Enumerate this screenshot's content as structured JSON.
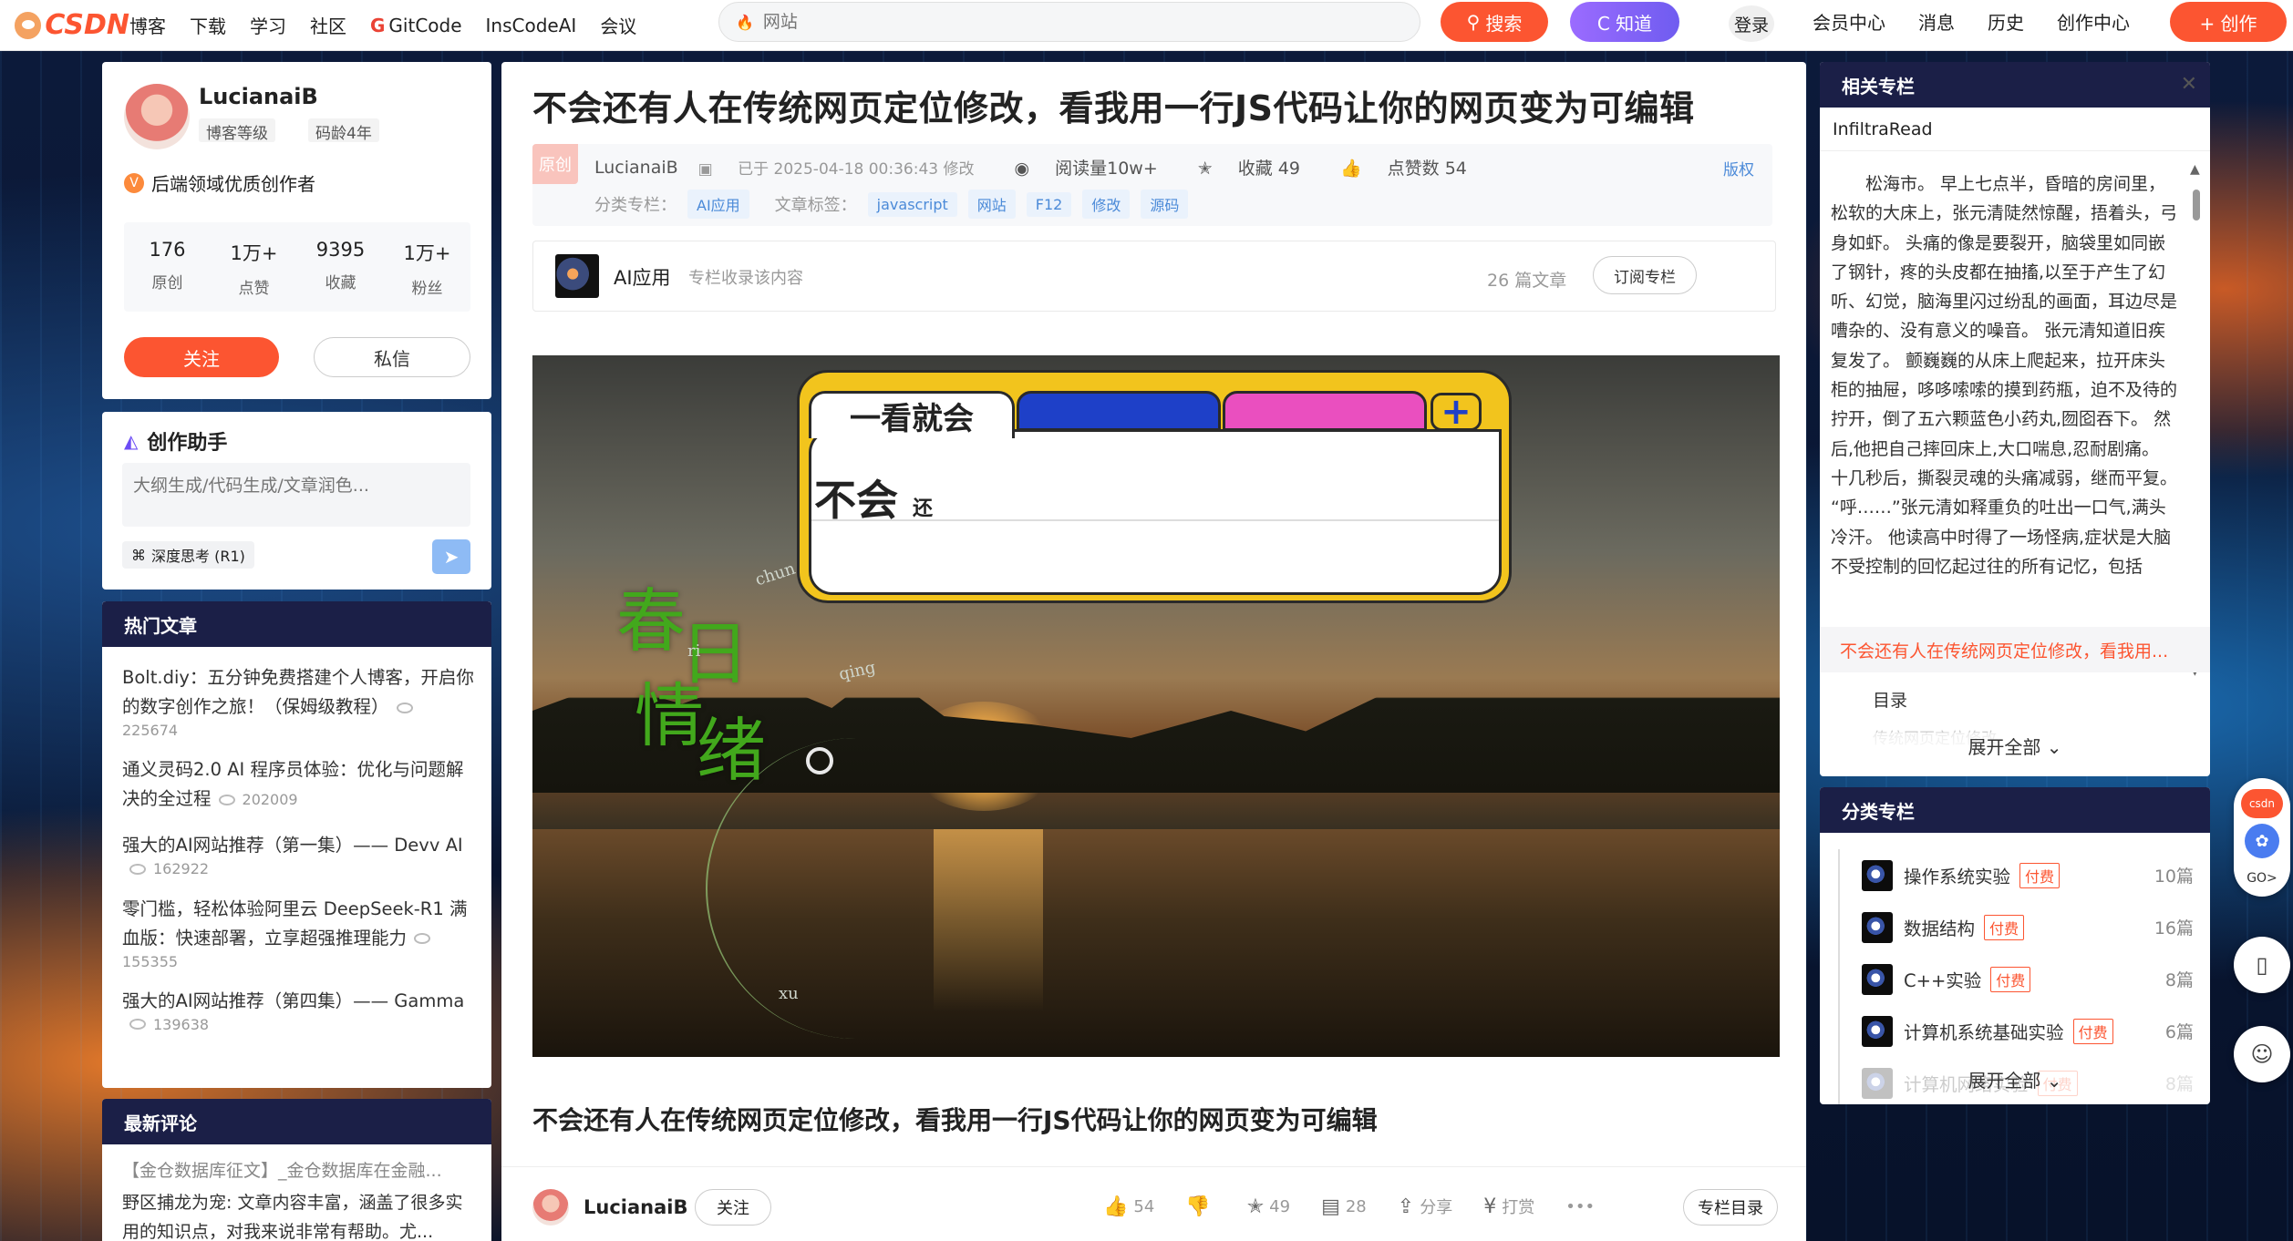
{
  "header": {
    "logo": "CSDN",
    "nav": [
      "博客",
      "下载",
      "学习",
      "社区",
      "GitCode",
      "InsCodeAI",
      "会议"
    ],
    "search_placeholder": "网站",
    "search_btn": "搜索",
    "zhidao_btn": "C 知道",
    "login": "登录",
    "right_nav": [
      "会员中心",
      "消息",
      "历史",
      "创作中心"
    ],
    "create_btn": "+ 创作"
  },
  "profile": {
    "name": "LucianaiB",
    "level": "博客等级",
    "age": "码龄4年",
    "cert": "后端领域优质创作者",
    "stats": [
      {
        "n": "176",
        "l": "原创"
      },
      {
        "n": "1万+",
        "l": "点赞"
      },
      {
        "n": "9395",
        "l": "收藏"
      },
      {
        "n": "1万+",
        "l": "粉丝"
      }
    ],
    "follow": "关注",
    "message": "私信"
  },
  "assistant": {
    "title": "创作助手",
    "placeholder": "大纲生成/代码生成/文章润色...",
    "deep": "深度思考 (R1)"
  },
  "hot": {
    "title": "热门文章",
    "items": [
      {
        "t": "Bolt.diy：五分钟免费搭建个人博客，开启你的数字创作之旅！（保姆级教程）",
        "v": "225674"
      },
      {
        "t": "通义灵码2.0 AI 程序员体验：优化与问题解决的全过程",
        "v": "202009"
      },
      {
        "t": "强大的AI网站推荐（第一集）—— Devv AI",
        "v": "162922"
      },
      {
        "t": "零门槛，轻松体验阿里云 DeepSeek-R1 满血版：快速部署，立享超强推理能力",
        "v": "155355"
      },
      {
        "t": "强大的AI网站推荐（第四集）—— Gamma",
        "v": "139638"
      }
    ]
  },
  "comments": {
    "title": "最新评论",
    "line1": "【金仓数据库征文】_金仓数据库在金融...",
    "line2": "野区捕龙为宠: 文章内容丰富，涵盖了很多实用的知识点，对我来说非常有帮助。尤..."
  },
  "article": {
    "title": "不会还有人在传统网页定位修改，看我用一行JS代码让你的网页变为可编辑",
    "badge": "原创",
    "author": "LucianaiB",
    "date": "已于 2025-04-18 00:36:43 修改",
    "reads": "阅读量10w+",
    "favs": "收藏 49",
    "likes": "点赞数 54",
    "copyright": "版权",
    "cat_label": "分类专栏：",
    "cat": "AI应用",
    "tags_label": "文章标签：",
    "tags": [
      "javascript",
      "网站",
      "F12",
      "修改",
      "源码"
    ],
    "column_name": "AI应用",
    "column_desc": "专栏收录该内容",
    "column_count": "26 篇文章",
    "subscribe": "订阅专栏",
    "image": {
      "tab1": "一看就会",
      "typing": "不会",
      "typing_small": "还",
      "plus": "+",
      "poem": [
        "春",
        "日",
        "情",
        "绪"
      ],
      "pinyin": [
        "chun",
        "ri",
        "qing",
        "xu"
      ]
    },
    "subtitle": "不会还有人在传统网页定位修改，看我用一行JS代码让你的网页变为可编辑",
    "bottom": {
      "author": "LucianaiB",
      "follow": "关注",
      "likes": "54",
      "favs": "49",
      "comments": "28",
      "share": "分享",
      "reward": "打赏",
      "more": "•••",
      "toc": "专栏目录"
    }
  },
  "related": {
    "title": "相关专栏",
    "window": "InfiltraRead",
    "text": "松海市。    早上七点半，昏暗的房间里，松软的大床上，张元清陡然惊醒，捂着头，弓身如虾。    头痛的像是要裂开，脑袋里如同嵌了钢针，疼的头皮都在抽搐,以至于产生了幻听、幻觉，脑海里闪过纷乱的画面，耳边尽是嘈杂的、没有意义的噪音。    张元清知道旧疾复发了。    颤巍巍的从床上爬起来，拉开床头柜的抽屉，哆哆嗦嗦的摸到药瓶，迫不及待的拧开，倒了五六颗蓝色小药丸,囫囵吞下。    然后,他把自己摔回床上,大口喘息,忍耐剧痛。    十几秒后，撕裂灵魂的头痛减弱，继而平复。    “呼……”张元清如释重负的吐出一口气,满头冷汗。    他读高中时得了一场怪病,症状是大脑不受控制的回忆起过往的所有记忆，包括",
    "active": "不会还有人在传统网页定位修改，看我用...",
    "toc": "目录",
    "fade": "传统网页定位修改",
    "more": "展开全部"
  },
  "categories": {
    "title": "分类专栏",
    "items": [
      {
        "name": "操作系统实验",
        "pay": "付费",
        "count": "10篇"
      },
      {
        "name": "数据结构",
        "pay": "付费",
        "count": "16篇"
      },
      {
        "name": "C++实验",
        "pay": "付费",
        "count": "8篇"
      },
      {
        "name": "计算机系统基础实验",
        "pay": "付费",
        "count": "6篇"
      },
      {
        "name": "计算机网络实验",
        "pay": "付费",
        "count": "8篇"
      }
    ],
    "more": "展开全部"
  },
  "float": {
    "csdn": "csdn",
    "go": "GO>"
  },
  "colors": {
    "accent": "#fc5531",
    "header_dark": "#1b1f47",
    "link": "#4b8ad8"
  }
}
